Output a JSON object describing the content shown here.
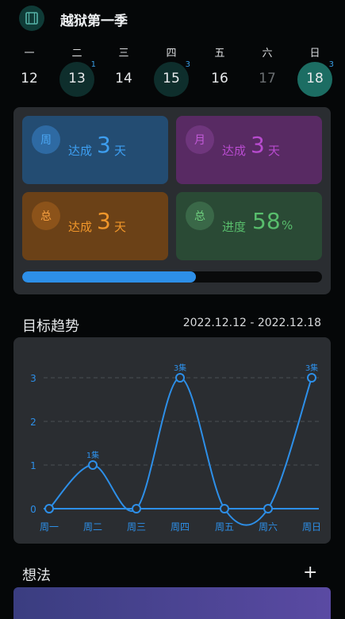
{
  "header": {
    "title": "越狱第一季",
    "icon": "film-icon"
  },
  "week": {
    "weekdays": [
      "一",
      "二",
      "三",
      "四",
      "五",
      "六",
      "日"
    ],
    "dates": [
      {
        "day": "12",
        "badge": "",
        "state": "normal"
      },
      {
        "day": "13",
        "badge": "1",
        "state": "done"
      },
      {
        "day": "14",
        "badge": "",
        "state": "normal"
      },
      {
        "day": "15",
        "badge": "3",
        "state": "done"
      },
      {
        "day": "16",
        "badge": "",
        "state": "normal"
      },
      {
        "day": "17",
        "badge": "",
        "state": "future"
      },
      {
        "day": "18",
        "badge": "3",
        "state": "today"
      }
    ]
  },
  "stats": {
    "week": {
      "tag": "周",
      "label": "达成",
      "value": "3",
      "unit": "天"
    },
    "month": {
      "tag": "月",
      "label": "达成",
      "value": "3",
      "unit": "天"
    },
    "total": {
      "tag": "总",
      "label": "达成",
      "value": "3",
      "unit": "天"
    },
    "progress": {
      "tag": "总",
      "label": "进度",
      "value": "58",
      "unit": "%",
      "fraction": 0.58
    }
  },
  "trend": {
    "title": "目标趋势",
    "range": "2022.12.12 - 2022.12.18"
  },
  "chart_data": {
    "type": "line",
    "categories": [
      "周一",
      "周二",
      "周三",
      "周四",
      "周五",
      "周六",
      "周日"
    ],
    "values": [
      0,
      1,
      0,
      3,
      0,
      0,
      3
    ],
    "point_labels": [
      "",
      "1集",
      "",
      "3集",
      "",
      "",
      "3集"
    ],
    "yticks": [
      "0",
      "1",
      "2",
      "3"
    ],
    "ylim": [
      0,
      3
    ],
    "grid": true,
    "color": "#2d8fe8"
  },
  "ideas": {
    "title": "想法",
    "add_icon": "plus-icon"
  },
  "colors": {
    "accent": "#2d8fe8",
    "today": "#1c6d63"
  }
}
